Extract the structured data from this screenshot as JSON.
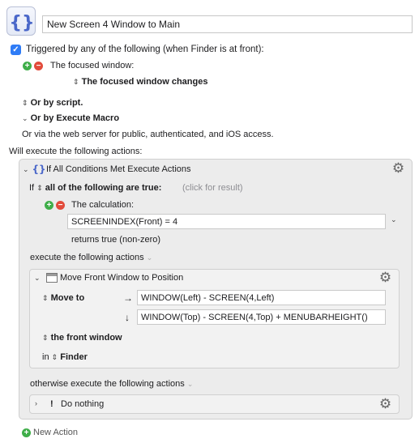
{
  "macro": {
    "icon": "curly-braces-icon",
    "name": "New Screen 4 Window to Main"
  },
  "trigger": {
    "header": "Triggered by any of the following (when Finder is at front):",
    "focused_window_label": "The focused window:",
    "focused_window_value": "The focused window changes",
    "or_by_script": "Or by script.",
    "or_by_execute_macro": "Or by Execute Macro",
    "web_server": "Or via the web server for public, authenticated, and iOS access."
  },
  "actions_header": "Will execute the following actions:",
  "if_action": {
    "title": "If All Conditions Met Execute Actions",
    "if_label": "If",
    "condition_mode": "all of the following are true:",
    "click_for_result": "(click for result)",
    "calculation_label": "The calculation:",
    "calculation_value": "SCREENINDEX(Front) = 4",
    "returns_text": "returns true (non-zero)",
    "execute_label": "execute the following actions",
    "otherwise_label": "otherwise execute the following actions"
  },
  "move_action": {
    "title": "Move Front Window to Position",
    "move_to_label": "Move to",
    "x_arrow": "→",
    "x_value": "WINDOW(Left) - SCREEN(4,Left)",
    "y_arrow": "↓",
    "y_value": "WINDOW(Top) - SCREEN(4,Top) + MENUBARHEIGHT()",
    "window_label": "the front window",
    "in_label": "in",
    "app_value": "Finder"
  },
  "do_nothing": {
    "bang": "!",
    "title": "Do nothing"
  },
  "new_action": "New Action",
  "colors": {
    "checkbox": "#2f7cf6",
    "add": "#3fae49",
    "remove": "#e24b3b"
  }
}
